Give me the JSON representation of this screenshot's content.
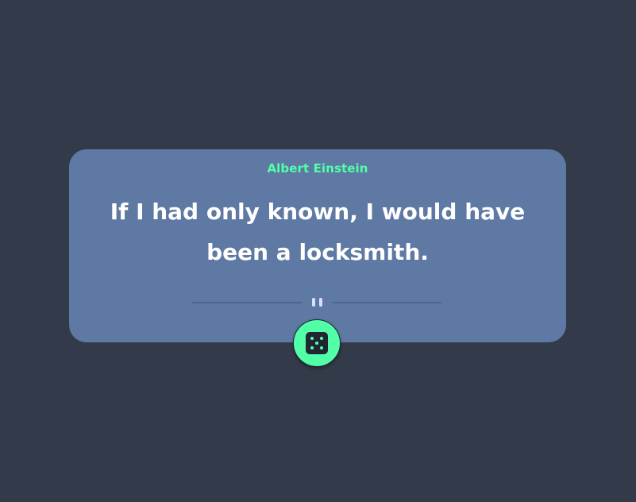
{
  "advice": {
    "author": "Albert Einstein",
    "quote": "If I had only known, I would have been a locksmith."
  },
  "colors": {
    "background": "#333a49",
    "card": "#5e79a3",
    "accent": "#52ffa8",
    "text": "#ffffff"
  },
  "icons": {
    "divider": "pause-icon",
    "button": "dice-icon"
  }
}
